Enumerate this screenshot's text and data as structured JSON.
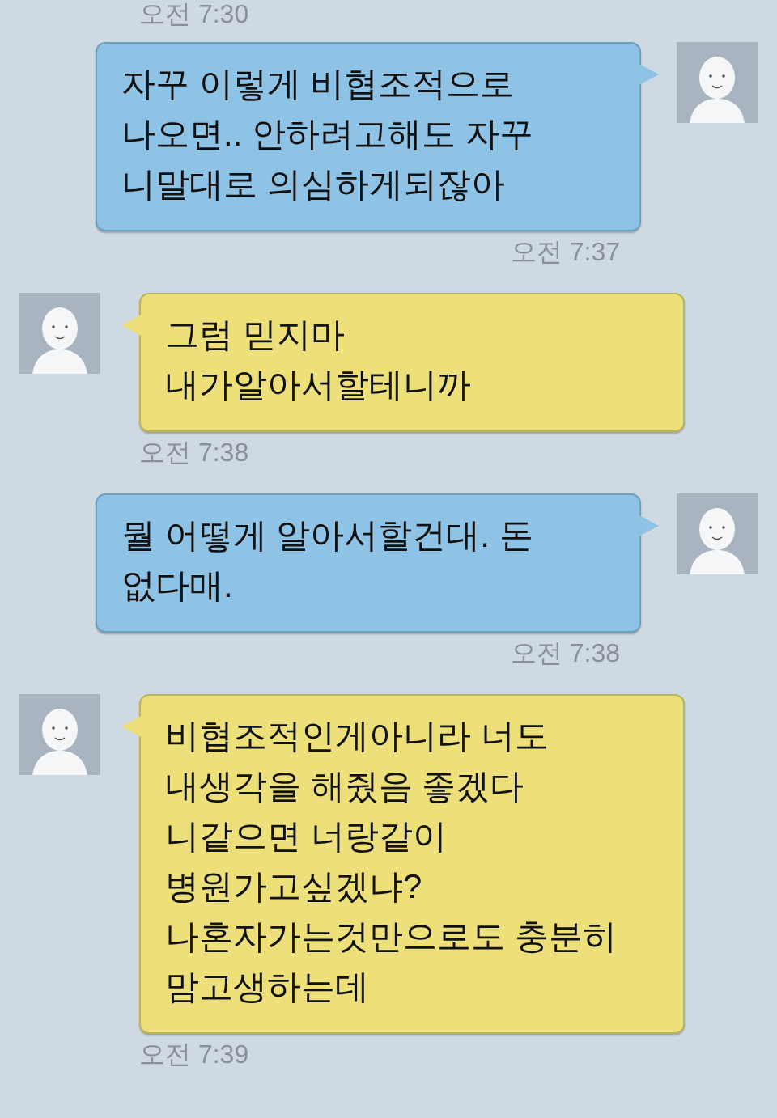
{
  "messages": [
    {
      "kind": "time_only",
      "time": "오전 7:30"
    },
    {
      "kind": "sent",
      "text": "자꾸 이렇게 비협조적으로\n나오면.. 안하려고해도 자꾸\n니말대로 의심하게되잖아",
      "time": "오전 7:37"
    },
    {
      "kind": "received",
      "text": "그럼 믿지마\n내가알아서할테니까",
      "time": "오전 7:38"
    },
    {
      "kind": "sent",
      "text": "뭘 어떻게 알아서할건대. 돈\n없다매.",
      "time": "오전 7:38"
    },
    {
      "kind": "received",
      "text": "비협조적인게아니라 너도\n내생각을 해줬음 좋겠다\n니같으면 너랑같이\n병원가고싶겠냐?\n나혼자가는것만으로도 충분히\n맘고생하는데",
      "time": "오전 7:39"
    }
  ]
}
